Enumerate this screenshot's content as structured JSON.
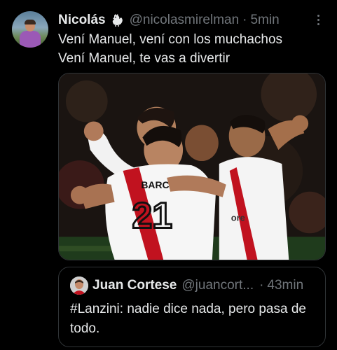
{
  "tweet": {
    "author_name": "Nicolás",
    "author_handle": "@nicolasmirelman",
    "separator": "·",
    "time": "5min",
    "text_lines": [
      "Vení Manuel, vení con los muchachos",
      "Vení Manuel, te vas a divertir"
    ]
  },
  "media": {
    "jersey_name": "BARCO",
    "jersey_number": "21",
    "sponsor": "ore"
  },
  "quoted_tweet": {
    "author_name": "Juan Cortese",
    "author_handle": "@juancort...",
    "separator": "·",
    "time": "43min",
    "text": "#Lanzini: nadie dice nada, pero pasa de todo."
  },
  "icons": [
    "avatar",
    "rooster-icon",
    "more-options-icon",
    "quoted-avatar"
  ]
}
